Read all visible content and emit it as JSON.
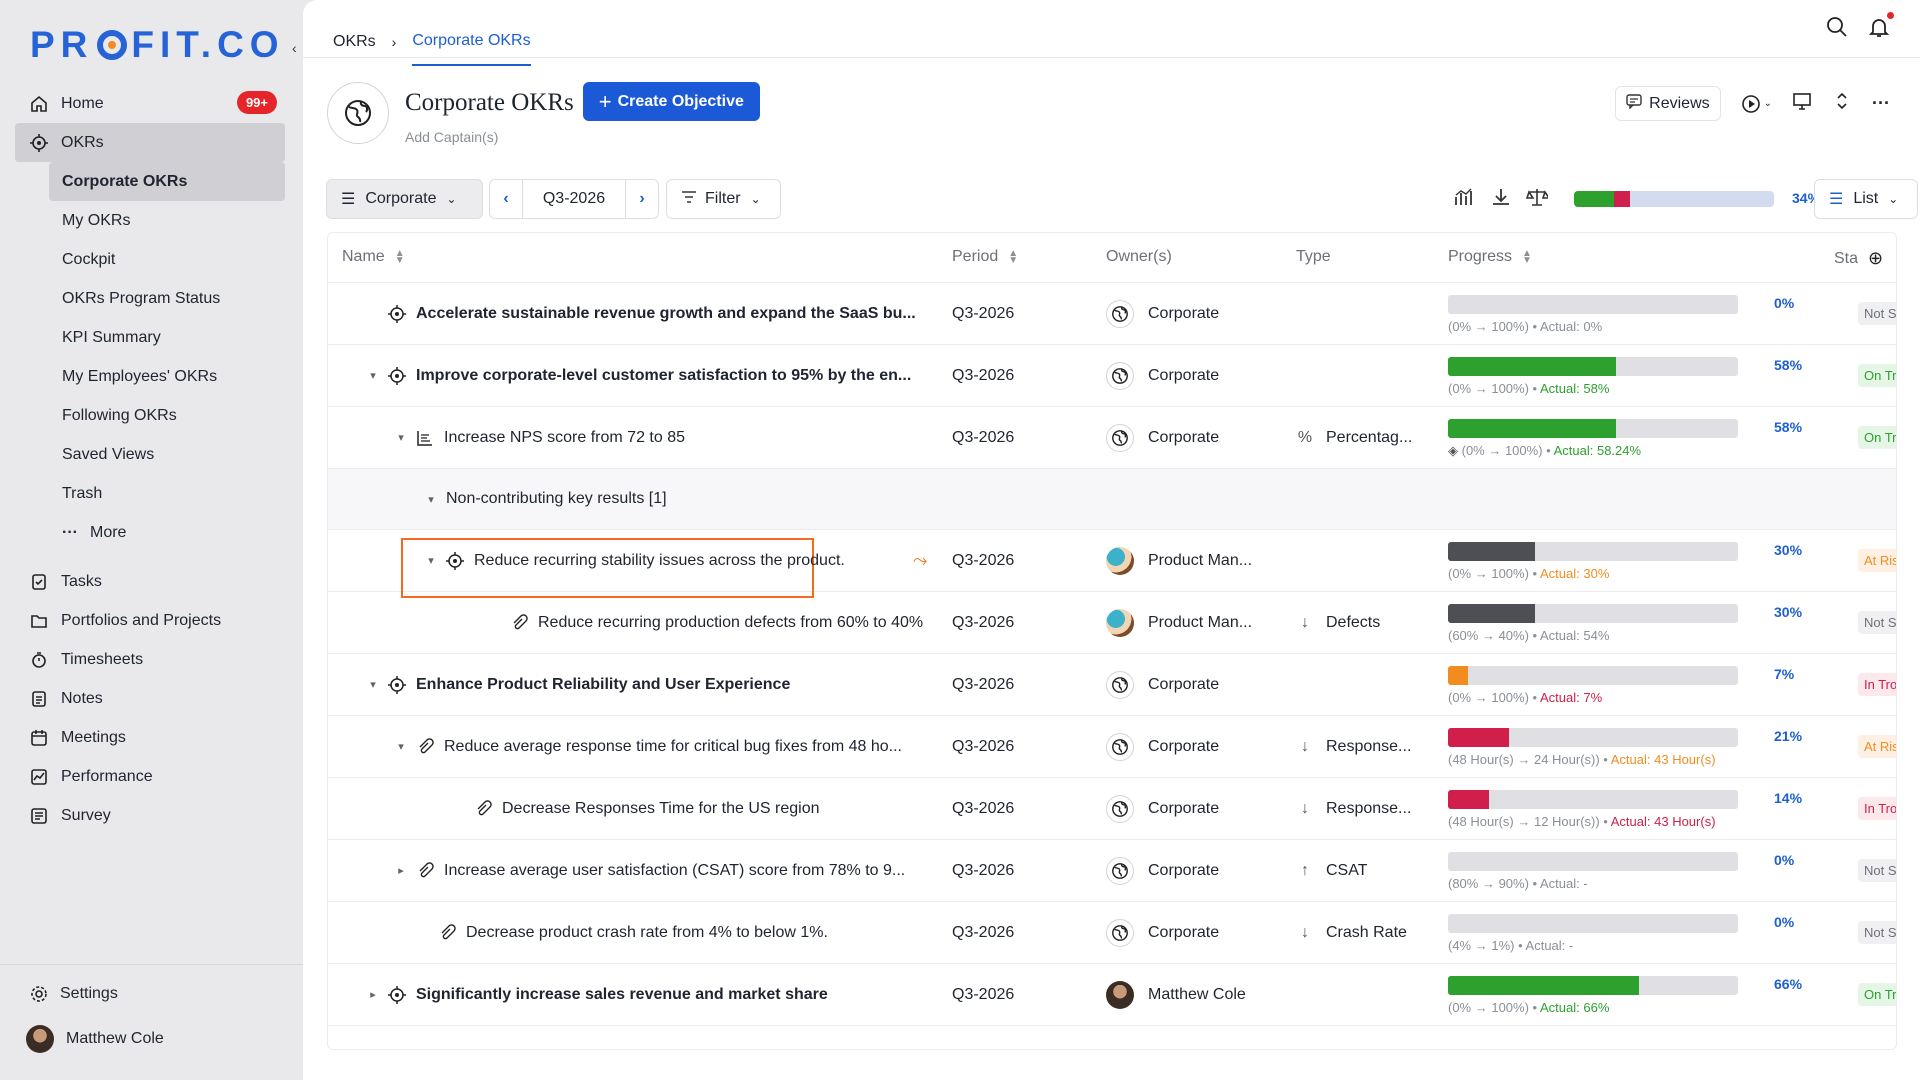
{
  "app": {
    "logo_text_pre": "PR",
    "logo_text_post": "FIT.CO"
  },
  "sidebar": {
    "home": {
      "label": "Home",
      "badge": "99+"
    },
    "okrs": {
      "label": "OKRs"
    },
    "okr_sub": [
      "Corporate OKRs",
      "My OKRs",
      "Cockpit",
      "OKRs Program Status",
      "KPI Summary",
      "My Employees' OKRs",
      "Following OKRs",
      "Saved Views",
      "Trash",
      "More"
    ],
    "main_items": [
      "Tasks",
      "Portfolios and Projects",
      "Timesheets",
      "Notes",
      "Meetings",
      "Performance",
      "Survey"
    ],
    "settings": "Settings",
    "user": "Matthew Cole"
  },
  "breadcrumb": {
    "root": "OKRs",
    "current": "Corporate OKRs"
  },
  "header": {
    "title": "Corporate OKRs",
    "create_label": "Create Objective",
    "captain": "Add Captain(s)",
    "reviews": "Reviews"
  },
  "toolbar": {
    "scope": "Corporate",
    "period": "Q3-2026",
    "filter": "Filter",
    "overall_pct": "34%",
    "overall_progress": {
      "green": 0.2,
      "red": 0.08
    },
    "view": "List"
  },
  "table": {
    "columns": {
      "name": "Name",
      "period": "Period",
      "owner": "Owner(s)",
      "type": "Type",
      "progress": "Progress",
      "status": "Sta"
    },
    "rows": [
      {
        "name": "Accelerate sustainable revenue growth and expand the SaaS bu...",
        "period": "Q3-2026",
        "owner": "Corporate",
        "type": "",
        "pct": "0%",
        "range": "(0% → 100%) •",
        "actual": "Actual: 0%",
        "status": "Not Sta"
      },
      {
        "name": "Improve corporate-level customer satisfaction to 95% by the en...",
        "period": "Q3-2026",
        "owner": "Corporate",
        "type": "",
        "pct": "58%",
        "range": "(0% → 100%) •",
        "actual": "Actual: 58%",
        "status": "On Trac"
      },
      {
        "name": "Increase NPS score from 72 to 85",
        "period": "Q3-2026",
        "owner": "Corporate",
        "type": "Percentag...",
        "pct": "58%",
        "range": "(0%  →  100%)  •",
        "actual": "Actual: 58.24%",
        "status": "On Trac"
      },
      {
        "name": "Non-contributing key results [1]"
      },
      {
        "name": "Reduce recurring stability issues across the product.",
        "period": "Q3-2026",
        "owner": "Product Man...",
        "type": "",
        "pct": "30%",
        "range": "(0% → 100%) •",
        "actual": "Actual: 30%",
        "status": "At Risk"
      },
      {
        "name": "Reduce recurring production defects from 60% to 40%",
        "period": "Q3-2026",
        "owner": "Product Man...",
        "type": "Defects",
        "pct": "30%",
        "range": "(60%  →  40%) •",
        "actual": "Actual: 54%",
        "status": "Not Sta"
      },
      {
        "name": "Enhance Product Reliability and User Experience",
        "period": "Q3-2026",
        "owner": "Corporate",
        "type": "",
        "pct": "7%",
        "range": "(0% → 100%) •",
        "actual": "Actual: 7%",
        "status": "In Troul"
      },
      {
        "name": "Reduce average response time for critical bug fixes from 48 ho...",
        "period": "Q3-2026",
        "owner": "Corporate",
        "type": "Response...",
        "pct": "21%",
        "range": "(48 Hour(s)  →  24 Hour(s)) •",
        "actual": "Actual: 43 Hour(s)",
        "status": "At Risk"
      },
      {
        "name": "Decrease Responses Time for the US region",
        "period": "Q3-2026",
        "owner": "Corporate",
        "type": "Response...",
        "pct": "14%",
        "range": "(48 Hour(s)  →  12 Hour(s)) •",
        "actual": "Actual: 43 Hour(s)",
        "status": "In Troul"
      },
      {
        "name": "Increase average user satisfaction (CSAT) score from 78% to 9...",
        "period": "Q3-2026",
        "owner": "Corporate",
        "type": "CSAT",
        "pct": "0%",
        "range": "(80%  →  90%) •",
        "actual": "Actual: -",
        "status": "Not Sta"
      },
      {
        "name": "Decrease product crash rate from 4% to below 1%.",
        "period": "Q3-2026",
        "owner": "Corporate",
        "type": "Crash Rate",
        "pct": "0%",
        "range": "(4%  →  1%) •",
        "actual": "Actual: -",
        "status": "Not Sta"
      },
      {
        "name": "Significantly increase sales revenue and market share",
        "period": "Q3-2026",
        "owner": "Matthew Cole",
        "type": "",
        "pct": "66%",
        "range": "(0% → 100%) •",
        "actual": "Actual: 66%",
        "status": "On Trac"
      }
    ]
  },
  "colors": {
    "brand": "#2563d6",
    "green": "#2ea02e",
    "red": "#cf1f4a",
    "orange": "#f28c1e",
    "gray": "#4d4f54",
    "status_not_started": "#f0f0f2",
    "status_on_track": "#e6f6e6",
    "status_at_risk": "#fff0e3",
    "status_trouble": "#fde8ec"
  }
}
